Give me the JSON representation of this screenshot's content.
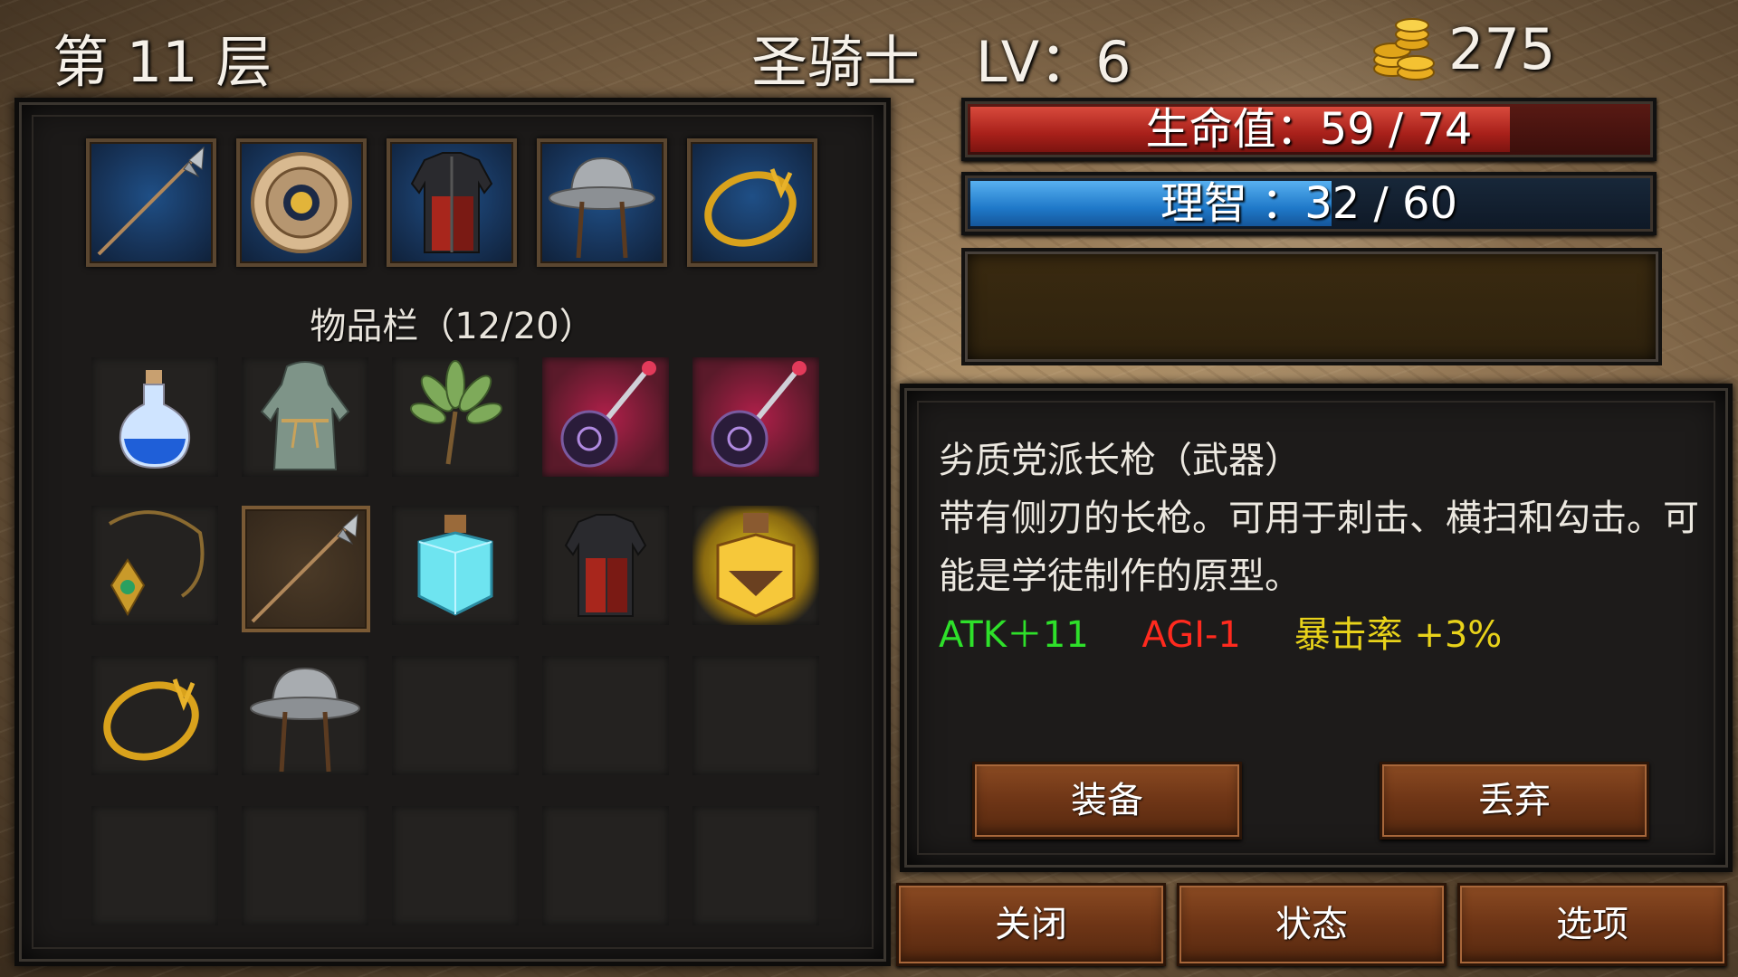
{
  "header": {
    "floor_label": "第 11 层",
    "class_level": "圣骑士　LV：6",
    "gold": "275",
    "gold_icon": "gold-coins-icon"
  },
  "bars": {
    "hp_label": "生命值：59 / 74",
    "hp_current": 59,
    "hp_max": 74,
    "hp_color": "#b8261e",
    "sp_label": "理智 ：32 / 60",
    "sp_current": 32,
    "sp_max": 60,
    "sp_color": "#1f79c9"
  },
  "message_box": "",
  "equipment": [
    {
      "icon": "spear-icon"
    },
    {
      "icon": "round-shield-icon"
    },
    {
      "icon": "red-armor-icon"
    },
    {
      "icon": "kettle-helmet-icon"
    },
    {
      "icon": "gold-ring-icon"
    }
  ],
  "inventory": {
    "title": "物品栏（12/20）",
    "count": 12,
    "capacity": 20,
    "items": [
      {
        "icon": "blue-potion-icon"
      },
      {
        "icon": "hooded-robe-icon"
      },
      {
        "icon": "herb-bundle-icon"
      },
      {
        "icon": "dark-flail-icon"
      },
      {
        "icon": "dark-flail-icon"
      },
      {
        "icon": "amulet-icon"
      },
      {
        "icon": "spear-icon",
        "selected": true
      },
      {
        "icon": "crystal-jar-icon"
      },
      {
        "icon": "red-armor-icon"
      },
      {
        "icon": "glowing-jar-icon"
      },
      {
        "icon": "gold-ring-icon"
      },
      {
        "icon": "kettle-helmet-icon"
      }
    ]
  },
  "description": {
    "title": "劣质党派长枪（武器）",
    "body": "带有侧刃的长枪。可用于刺击、横扫和勾击。可能是学徒制作的原型。",
    "stats": [
      {
        "text": "ATK＋11",
        "color": "#2ee02a"
      },
      {
        "text": "AGI-1",
        "color": "#ff2a1e"
      },
      {
        "text": "暴击率 +3%",
        "color": "#e8d21a"
      }
    ]
  },
  "buttons": {
    "equip": "装备",
    "discard": "丢弃",
    "close": "关闭",
    "status": "状态",
    "options": "选项"
  }
}
